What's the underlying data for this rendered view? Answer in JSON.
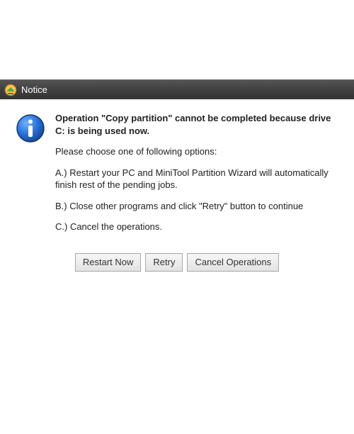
{
  "titlebar": {
    "title": "Notice"
  },
  "message": {
    "headline": "Operation \"Copy partition\" cannot be completed because drive C: is being used now.",
    "intro": "Please choose one of following options:",
    "optionA": "A.) Restart your PC and MiniTool Partition Wizard will automatically finish rest of the pending jobs.",
    "optionB": "B.) Close other programs and click \"Retry\" button to continue",
    "optionC": "C.) Cancel the operations."
  },
  "buttons": {
    "restart": "Restart Now",
    "retry": "Retry",
    "cancel": "Cancel Operations"
  }
}
